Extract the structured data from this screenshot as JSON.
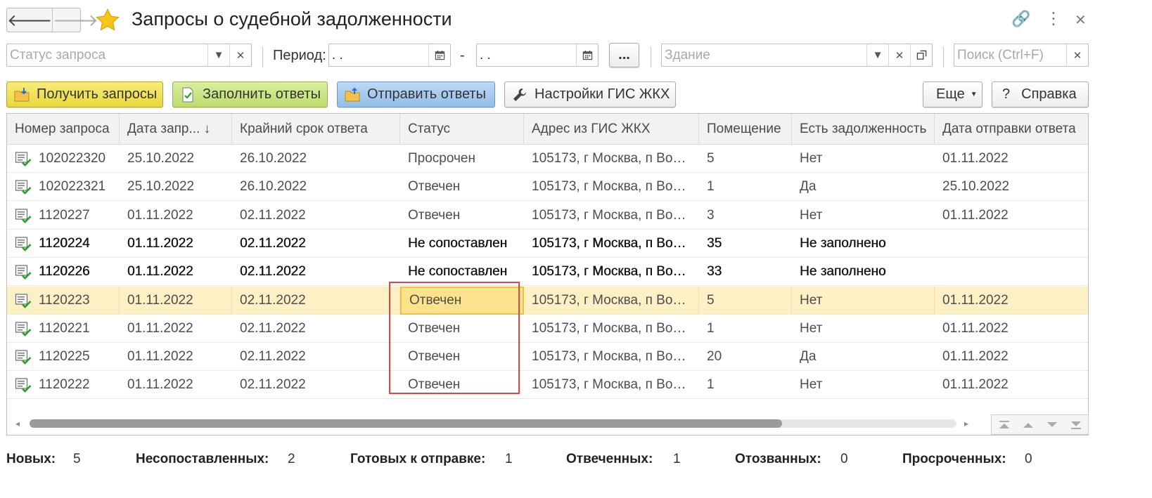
{
  "window": {
    "title": "Запросы о судебной задолженности",
    "back_glyph": "🡐",
    "forward_glyph": "🡒",
    "link_glyph": "🔗",
    "more_glyph": "⋮",
    "close_glyph": "✕"
  },
  "filters": {
    "status_placeholder": "Статус запроса",
    "period_label": "Период:",
    "period_from": " .  .",
    "period_dash": "-",
    "period_to": " .  .",
    "period_more": "...",
    "building_placeholder": "Здание",
    "search_placeholder": "Поиск (Ctrl+F)"
  },
  "commands": {
    "get_requests": "Получить запросы",
    "fill_answers": "Заполнить ответы",
    "send_answers": "Отправить ответы",
    "gis_settings": "Настройки ГИС ЖКХ",
    "more": "Еще",
    "help": "Справка",
    "help_glyph": "?"
  },
  "table": {
    "columns": [
      "Номер запроса",
      "Дата запр... ↓",
      "Крайний срок ответа",
      "Статус",
      "Адрес из ГИС ЖКХ",
      "Помещение",
      "Есть задолженность",
      "Дата отправки ответа"
    ],
    "rows": [
      [
        "102022320",
        "25.10.2022",
        "26.10.2022",
        "Просрочен",
        "105173, г Москва, п Во…",
        "5",
        "Нет",
        "01.11.2022"
      ],
      [
        "102022321",
        "25.10.2022",
        "26.10.2022",
        "Отвечен",
        "105173, г Москва, п Во…",
        "1",
        "Да",
        "25.10.2022"
      ],
      [
        "1120227",
        "01.11.2022",
        "02.11.2022",
        "Отвечен",
        "105173, г Москва, п Во…",
        "3",
        "Нет",
        "01.11.2022"
      ],
      [
        "1120224",
        "01.11.2022",
        "02.11.2022",
        "Не сопоставлен",
        "105173, г Москва, п Во…",
        "35",
        "Не заполнено",
        ""
      ],
      [
        "1120226",
        "01.11.2022",
        "02.11.2022",
        "Не сопоставлен",
        "105173, г Москва, п Во…",
        "33",
        "Не заполнено",
        ""
      ],
      [
        "1120223",
        "01.11.2022",
        "02.11.2022",
        "Отвечен",
        "105173, г Москва, п Во…",
        "5",
        "Нет",
        "01.11.2022"
      ],
      [
        "1120221",
        "01.11.2022",
        "02.11.2022",
        "Отвечен",
        "105173, г Москва, п Во…",
        "1",
        "Нет",
        "01.11.2022"
      ],
      [
        "1120225",
        "01.11.2022",
        "02.11.2022",
        "Отвечен",
        "105173, г Москва, п Во…",
        "20",
        "Да",
        "01.11.2022"
      ],
      [
        "1120222",
        "01.11.2022",
        "02.11.2022",
        "Отвечен",
        "105173, г Москва, п Во…",
        "1",
        "Нет",
        "01.11.2022"
      ]
    ],
    "bold_rows": [
      3,
      4
    ],
    "selected_row": 5,
    "focused_column": 3
  },
  "footer": {
    "new_label": "Новых:",
    "new_value": "5",
    "unmatched_label": "Несопоставленных:",
    "unmatched_value": "2",
    "ready_label": "Готовых к отправке:",
    "ready_value": "1",
    "answered_label": "Отвеченных:",
    "answered_value": "1",
    "revoked_label": "Отозванных:",
    "revoked_value": "0",
    "overdue_label": "Просроченных:",
    "overdue_value": "0"
  },
  "colors": {
    "accent_star": "#f5c518",
    "selected_row": "#fbf1c5",
    "highlight_frame": "#e04444"
  }
}
